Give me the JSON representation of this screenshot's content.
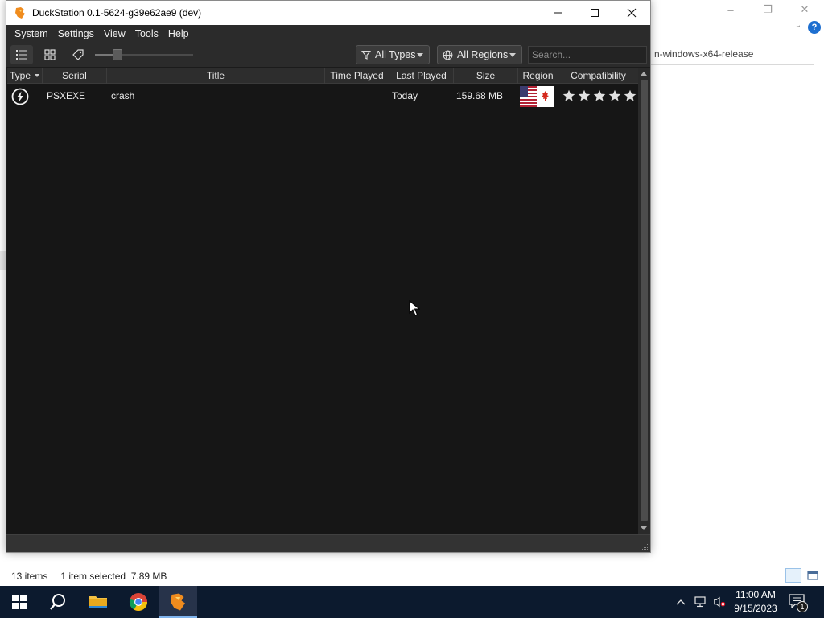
{
  "background_window": {
    "address_text": "n-windows-x64-release",
    "help_label": "?",
    "status": {
      "item_count": "13 items",
      "selection": "1 item selected  7.89 MB"
    }
  },
  "app": {
    "title": "DuckStation 0.1-5624-g39e62ae9 (dev)",
    "menu": [
      "System",
      "Settings",
      "View",
      "Tools",
      "Help"
    ],
    "toolbar": {
      "type_filter": "All Types",
      "region_filter": "All Regions",
      "search_placeholder": "Search...",
      "zoom_level": 0.2
    },
    "table": {
      "columns": [
        "Type",
        "Serial",
        "Title",
        "Time Played",
        "Last Played",
        "Size",
        "Region",
        "Compatibility"
      ],
      "rows": [
        {
          "type_icon": "lightning-icon",
          "serial": "PSXEXE",
          "title": "crash",
          "time_played": "",
          "last_played": "Today",
          "size": "159.68 MB",
          "region_icon": "us-canada-flag-icon",
          "compatibility_stars": 5
        }
      ]
    }
  },
  "taskbar": {
    "clock_time": "11:00 AM",
    "clock_date": "9/15/2023",
    "notification_count": "1"
  },
  "colors": {
    "app_bg": "#1b1b1b",
    "toolbar_bg": "#2b2b2b",
    "taskbar_bg": "#0c1a2e",
    "accent": "#1e6fd0"
  }
}
